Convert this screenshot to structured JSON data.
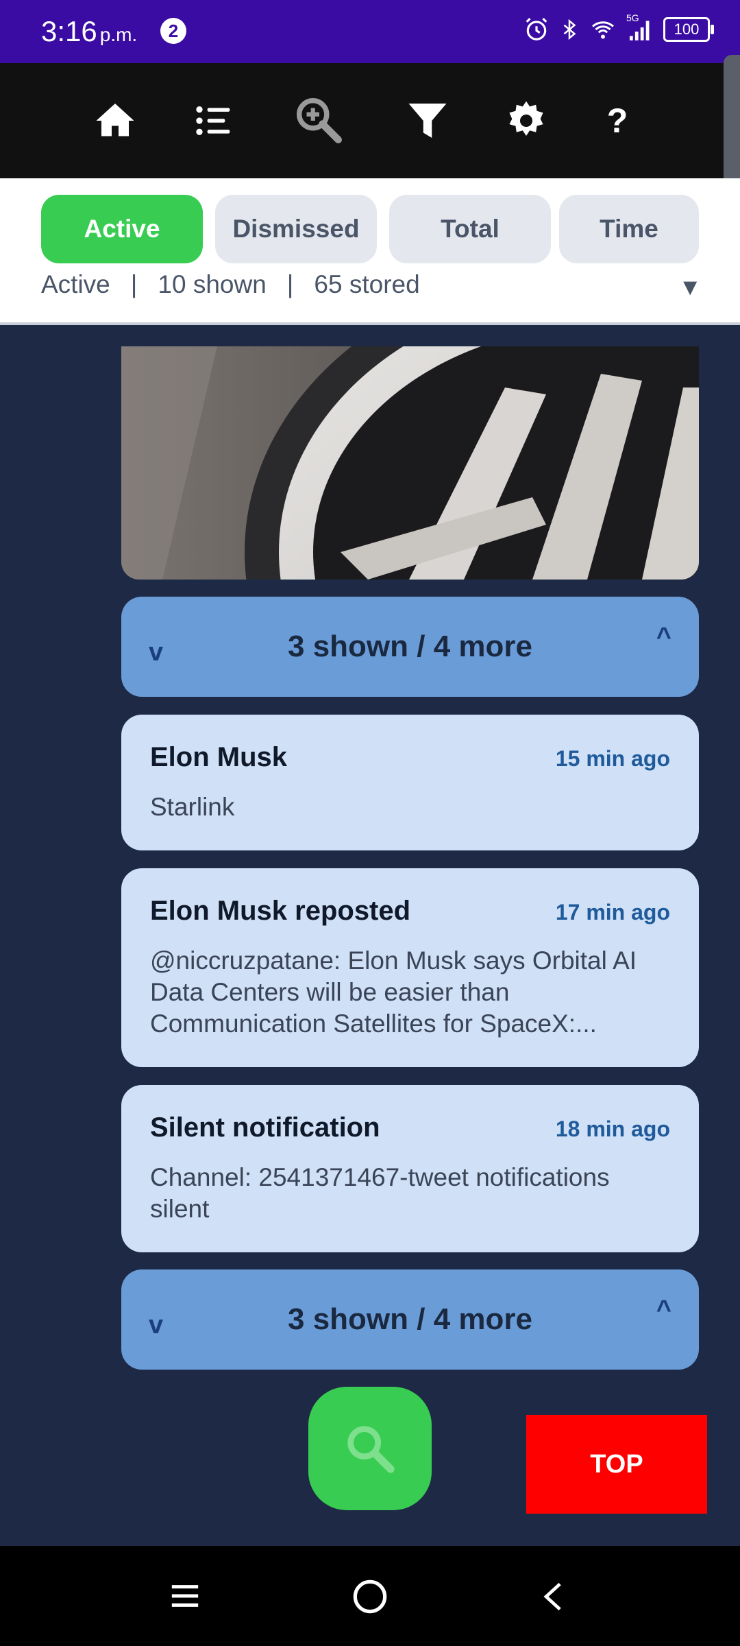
{
  "status_bar": {
    "time": "3:16",
    "ampm": "p.m.",
    "notification_count": "2",
    "network": "5G",
    "battery": "100"
  },
  "toolbar": {
    "icons": [
      "home-icon",
      "list-icon",
      "zoom-in-icon",
      "filter-icon",
      "settings-icon",
      "help-icon"
    ]
  },
  "filters": {
    "tabs": [
      {
        "label": "Active",
        "active": true
      },
      {
        "label": "Dismissed",
        "active": false
      },
      {
        "label": "Total",
        "active": false
      },
      {
        "label": "Time",
        "active": false
      }
    ],
    "summary": {
      "state": "Active",
      "shown": "10 shown",
      "stored": "65 stored",
      "separator": "|"
    },
    "dropdown": "▼"
  },
  "groups": [
    {
      "label": "3 shown / 4 more",
      "left_arrow": "v",
      "right_arrow": "^"
    },
    {
      "label": "3 shown / 4 more",
      "left_arrow": "v",
      "right_arrow": "^"
    }
  ],
  "notifications": [
    {
      "title": "Elon Musk",
      "time": "15 min ago",
      "body": "Starlink"
    },
    {
      "title": "Elon Musk reposted",
      "time": "17 min ago",
      "body": "@niccruzpatane: Elon Musk says Orbital AI Data Centers will be easier than Communication Satellites for SpaceX:..."
    },
    {
      "title": "Silent notification",
      "time": "18 min ago",
      "body": "Channel: 2541371467-tweet notifications silent"
    }
  ],
  "actions": {
    "top_label": "TOP"
  },
  "colors": {
    "status_bar": "#3a0ca3",
    "accent_green": "#38cd52",
    "group_bg": "#6a9cd8",
    "card_bg": "#cfe0f7",
    "top_button": "#ff0000",
    "background": "#1e2a45"
  }
}
